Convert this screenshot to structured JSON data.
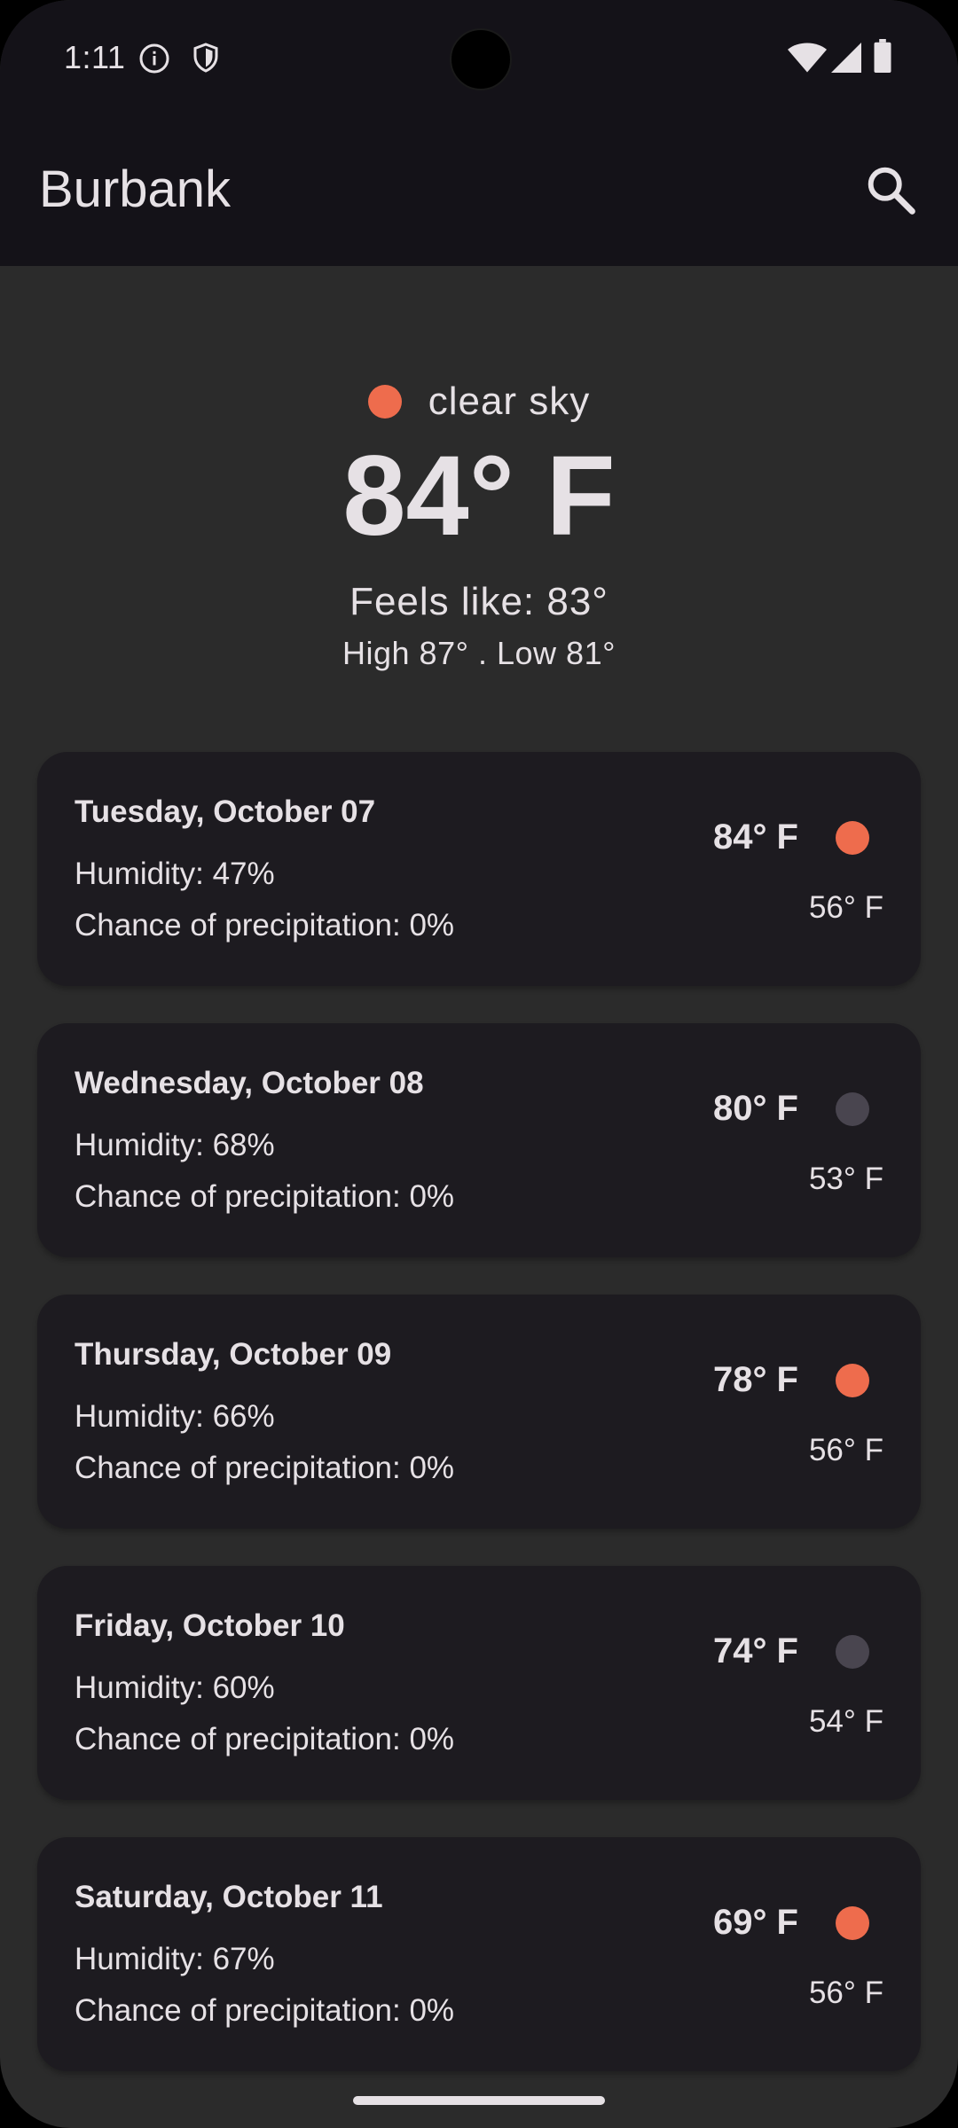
{
  "status_bar": {
    "time": "1:11",
    "icons": [
      "info-icon",
      "shield-icon",
      "wifi-icon",
      "cell-signal-icon",
      "battery-icon"
    ]
  },
  "app_bar": {
    "title": "Burbank",
    "search_icon": "search-icon"
  },
  "current": {
    "condition": "clear sky",
    "temperature": "84° F",
    "feels_like": "Feels like: 83°",
    "high_low": "High 87° . Low 81°",
    "dot_color": "#ee6c4d"
  },
  "forecast": [
    {
      "date": "Tuesday, October 07",
      "humidity": "Humidity: 47%",
      "precipitation": "Chance of precipitation: 0%",
      "high": "84° F",
      "low": "56° F",
      "dot_color": "#ee6c4d"
    },
    {
      "date": "Wednesday, October 08",
      "humidity": "Humidity: 68%",
      "precipitation": "Chance of precipitation: 0%",
      "high": "80° F",
      "low": "53° F",
      "dot_color": "#49454f"
    },
    {
      "date": "Thursday, October 09",
      "humidity": "Humidity: 66%",
      "precipitation": "Chance of precipitation: 0%",
      "high": "78° F",
      "low": "56° F",
      "dot_color": "#ee6c4d"
    },
    {
      "date": "Friday, October 10",
      "humidity": "Humidity: 60%",
      "precipitation": "Chance of precipitation: 0%",
      "high": "74° F",
      "low": "54° F",
      "dot_color": "#49454f"
    },
    {
      "date": "Saturday, October 11",
      "humidity": "Humidity: 67%",
      "precipitation": "Chance of precipitation: 0%",
      "high": "69° F",
      "low": "56° F",
      "dot_color": "#ee6c4d"
    }
  ],
  "colors": {
    "background": "#2b2b2b",
    "bar": "#141218",
    "card": "#1d1b20",
    "text": "#e6e1e5",
    "accent": "#ee6c4d",
    "muted_dot": "#49454f"
  }
}
